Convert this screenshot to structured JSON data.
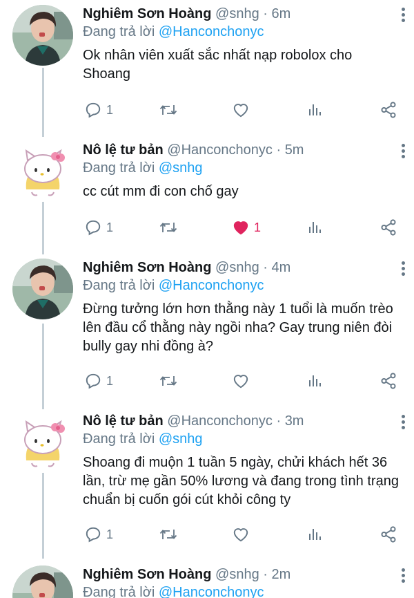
{
  "tweets": [
    {
      "name": "Nghiêm Sơn Hoàng",
      "handle": "@snhg",
      "time": "6m",
      "reply_prefix": "Đang trả lời",
      "reply_to": "@Hanconchonyc",
      "text": "Ok nhân viên xuất sắc nhất nạp robolox cho Shoang",
      "reply_count": "1",
      "like_count": "",
      "liked": false,
      "avatar": "person"
    },
    {
      "name": "Nô lệ tư bản",
      "handle": "@Hanconchonyc",
      "time": "5m",
      "reply_prefix": "Đang trả lời",
      "reply_to": "@snhg",
      "text": "cc cút mm đi con chố gay",
      "reply_count": "1",
      "like_count": "1",
      "liked": true,
      "avatar": "hello-kitty"
    },
    {
      "name": "Nghiêm Sơn Hoàng",
      "handle": "@snhg",
      "time": "4m",
      "reply_prefix": "Đang trả lời",
      "reply_to": "@Hanconchonyc",
      "text": "Đừng tưởng lớn hơn thằng này 1 tuổi là muốn trèo lên đầu cổ thằng này ngồi nha? Gay trung niên đòi bully gay nhi đồng à?",
      "reply_count": "1",
      "like_count": "",
      "liked": false,
      "avatar": "person"
    },
    {
      "name": "Nô lệ tư bản",
      "handle": "@Hanconchonyc",
      "time": "3m",
      "reply_prefix": "Đang trả lời",
      "reply_to": "@snhg",
      "text": "Shoang đi muộn 1 tuần 5 ngày, chửi khách hết 36 lần, trừ mẹ gần 50% lương và đang trong tình trạng chuẩn bị cuốn gói cút khỏi công ty",
      "reply_count": "1",
      "like_count": "",
      "liked": false,
      "avatar": "hello-kitty"
    },
    {
      "name": "Nghiêm Sơn Hoàng",
      "handle": "@snhg",
      "time": "2m",
      "reply_prefix": "Đang trả lời",
      "reply_to": "@Hanconchonyc",
      "avatar": "person"
    }
  ],
  "separator": "·",
  "colors": {
    "text": "#14171a",
    "muted": "#657786",
    "link": "#1da1f2",
    "like": "#e0245e",
    "thread_line": "#c4cfd6"
  },
  "icons": [
    "reply-icon",
    "retweet-icon",
    "like-icon",
    "analytics-icon",
    "share-icon",
    "more-icon"
  ]
}
